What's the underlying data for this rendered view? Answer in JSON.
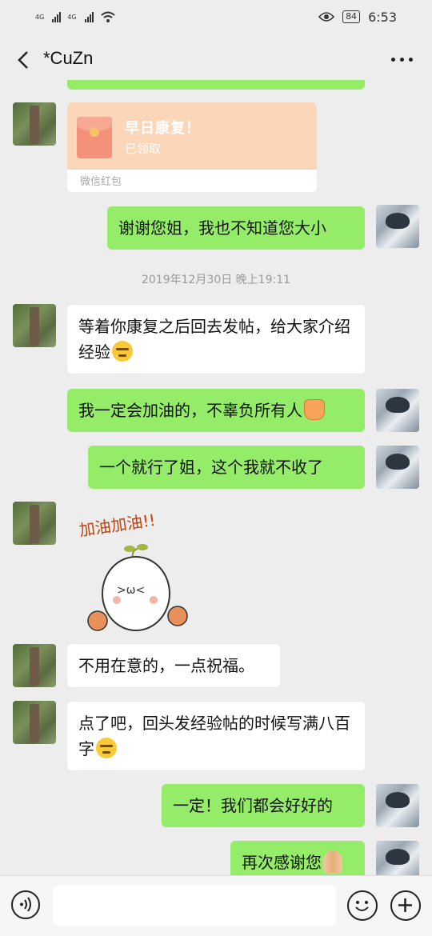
{
  "status_bar": {
    "net1": "4G",
    "net2": "4G",
    "battery": "84",
    "time": "6:53"
  },
  "header": {
    "title": "*CuZn"
  },
  "messages": {
    "red_packet": {
      "title": "早日康复！",
      "status": "已领取",
      "footer": "微信红包"
    },
    "m1": "谢谢您姐，我也不知道您大小",
    "timestamp": "2019年12月30日 晚上19:11",
    "m2": "等着你康复之后回去发帖，给大家介绍经验",
    "m3": "我一定会加油的，不辜负所有人",
    "m4": "一个就行了姐，这个我就不收了",
    "sticker_text": "加油加油!!",
    "m5": "不用在意的，一点祝福。",
    "m6": "点了吧，回头发经验帖的时候写满八百字",
    "m7": "一定！我们都会好好的",
    "m8": "再次感谢您"
  },
  "icons": {
    "back": "chevron-left-icon",
    "more": "more-dots-icon",
    "voice": "voice-icon",
    "emoji": "emoji-icon",
    "plus": "plus-icon"
  }
}
